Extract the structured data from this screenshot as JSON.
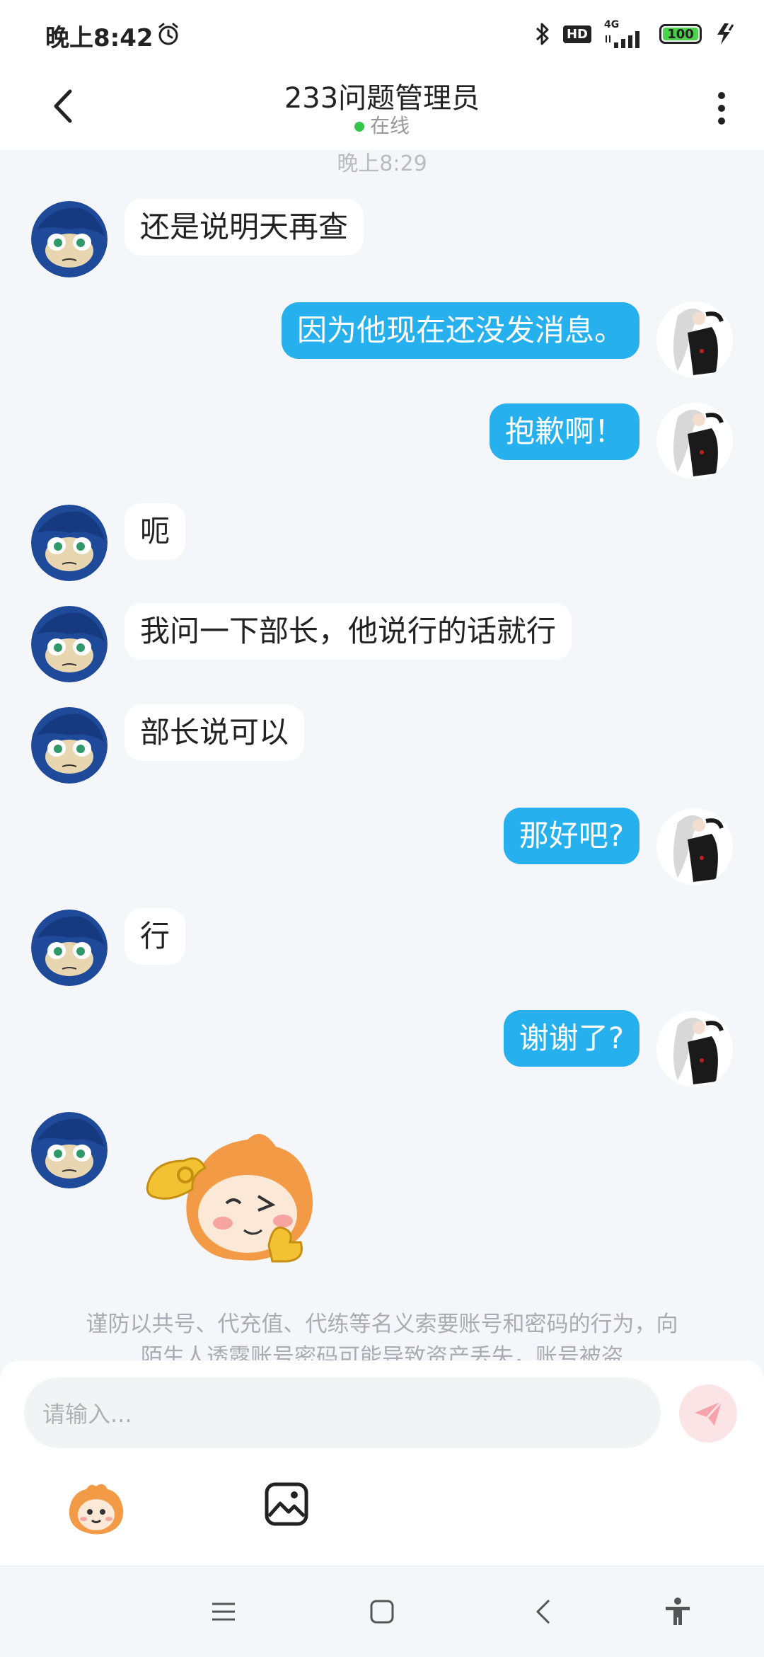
{
  "status_bar": {
    "time": "晚上8:42",
    "network": "4G",
    "hd": "HD",
    "battery": "100",
    "battery_level": 1.0
  },
  "header": {
    "title": "233问题管理员",
    "status": "在线"
  },
  "chat": {
    "timestamp": "晚上8:29",
    "messages": [
      {
        "side": "left",
        "text": "还是说明天再查"
      },
      {
        "side": "right",
        "text": "因为他现在还没发消息。"
      },
      {
        "side": "right",
        "text": "抱歉啊！"
      },
      {
        "side": "left",
        "text": "呃"
      },
      {
        "side": "left",
        "text": "我问一下部长，他说行的话就行"
      },
      {
        "side": "left",
        "text": "部长说可以"
      },
      {
        "side": "right",
        "text": "那好吧?"
      },
      {
        "side": "left",
        "text": "行"
      },
      {
        "side": "right",
        "text": "谢谢了?"
      }
    ]
  },
  "notice": {
    "line1": "谨防以共号、代充值、代练等名义索要账号和密码的行为，向",
    "line2": "陌生人透露账号密码可能导致资产丢失，账号被盗"
  },
  "input": {
    "placeholder": "请输入..."
  },
  "colors": {
    "accent": "#26b1ee",
    "background": "#f4f6f9",
    "online": "#35c44a",
    "send_disabled": "#fbe4e6"
  },
  "icons": [
    "back-arrow-icon",
    "more-vertical-icon",
    "alarm-icon",
    "bluetooth-icon",
    "signal-icon",
    "battery-icon",
    "charging-icon",
    "send-icon",
    "emoji-icon",
    "image-icon",
    "menu-icon",
    "home-icon",
    "back-icon",
    "accessibility-icon"
  ]
}
